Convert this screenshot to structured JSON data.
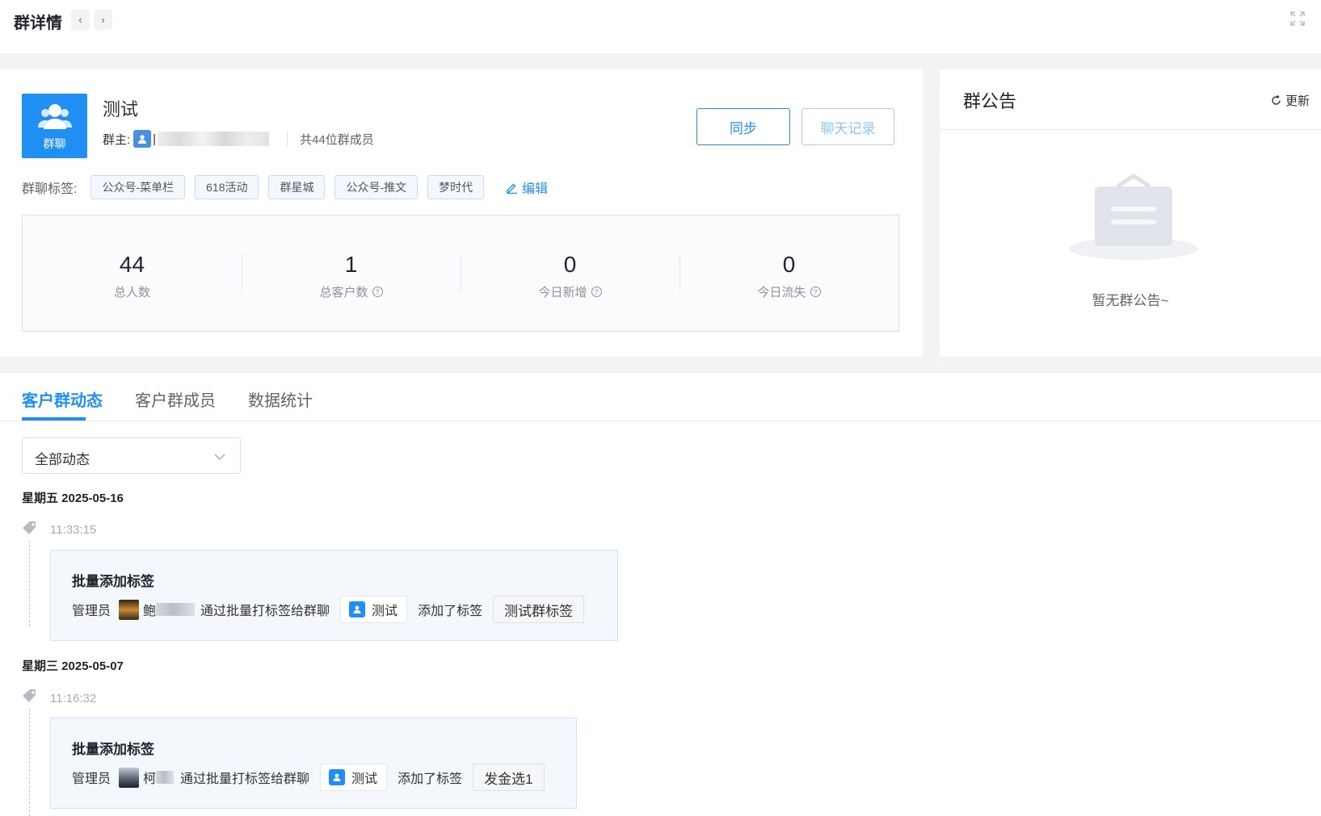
{
  "header": {
    "title": "群详情",
    "prev_icon": "chevron-left-icon",
    "next_icon": "chevron-right-icon",
    "expand_icon": "fullscreen-icon"
  },
  "group": {
    "avatar_label": "群聊",
    "name": "测试",
    "owner_label": "群主:",
    "owner_initial": "|",
    "member_count_text": "共44位群成员",
    "sync_button": "同步",
    "chat_button": "聊天记录",
    "tags_label": "群聊标签:",
    "tags": [
      "公众号-菜单栏",
      "618活动",
      "群星城",
      "公众号-推文",
      "梦时代"
    ],
    "edit_label": "编辑"
  },
  "stats": [
    {
      "value": "44",
      "label": "总人数",
      "has_help": false
    },
    {
      "value": "1",
      "label": "总客户数",
      "has_help": true
    },
    {
      "value": "0",
      "label": "今日新增",
      "has_help": true
    },
    {
      "value": "0",
      "label": "今日流失",
      "has_help": true
    }
  ],
  "notice": {
    "title": "群公告",
    "update_label": "更新",
    "empty_text": "暂无群公告~"
  },
  "tabs": [
    {
      "label": "客户群动态",
      "active": true
    },
    {
      "label": "客户群成员",
      "active": false
    },
    {
      "label": "数据统计",
      "active": false
    }
  ],
  "filter": {
    "selected": "全部动态"
  },
  "timeline": [
    {
      "date": "星期五 2025-05-16",
      "time": "11:33:15",
      "title": "批量添加标签",
      "admin_label": "管理员",
      "admin_initial": "鲍",
      "action_text": "通过批量打标签给群聊",
      "group_name": "测试",
      "added_text": "添加了标签",
      "tag": "测试群标签"
    },
    {
      "date": "星期三 2025-05-07",
      "time": "11:16:32",
      "title": "批量添加标签",
      "admin_label": "管理员",
      "admin_initial": "柯",
      "action_text": "通过批量打标签给群聊",
      "group_name": "测试",
      "added_text": "添加了标签",
      "tag": "发金选1"
    }
  ],
  "colors": {
    "primary": "#1f8ff4",
    "background": "#f2f3f5",
    "stats_border": "#cfe3f6"
  }
}
